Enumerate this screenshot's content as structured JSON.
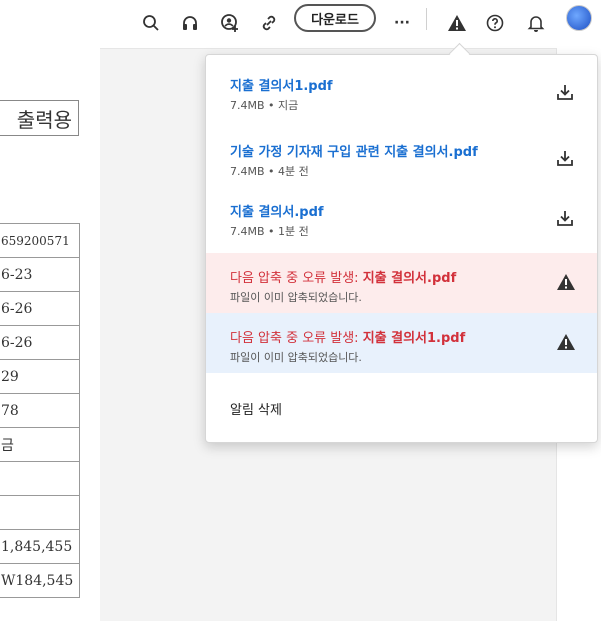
{
  "toolbar": {
    "download_label": "다운로드",
    "more_label": "···"
  },
  "document": {
    "title_fragment": "출력용",
    "table_cells": [
      "659200571",
      "6-23",
      "6-26",
      "6-26",
      "29",
      "78",
      "금",
      "",
      "",
      "1,845,455",
      "W184,545"
    ]
  },
  "downloads": {
    "items": [
      {
        "name": "지출 결의서1.pdf",
        "meta": "7.4MB • 지금"
      },
      {
        "name": "기술 가정 기자재 구입 관련 지출 결의서.pdf",
        "meta": "7.4MB • 4분 전"
      },
      {
        "name": "지출 결의서.pdf",
        "meta": "7.4MB • 1분 전"
      }
    ],
    "errors": [
      {
        "prefix": "다음 압축 중 오류 발생: ",
        "file": "지출 결의서.pdf",
        "detail": "파일이 이미 압축되었습니다.",
        "bg": "#fdecec"
      },
      {
        "prefix": "다음 압축 중 오류 발생: ",
        "file": "지출 결의서1.pdf",
        "detail": "파일이 이미 압축되었습니다.",
        "bg": "#e8f1fc"
      }
    ],
    "clear_label": "알림 삭제"
  },
  "colors": {
    "accent": "#1a6fd1",
    "error": "#d2313b"
  }
}
